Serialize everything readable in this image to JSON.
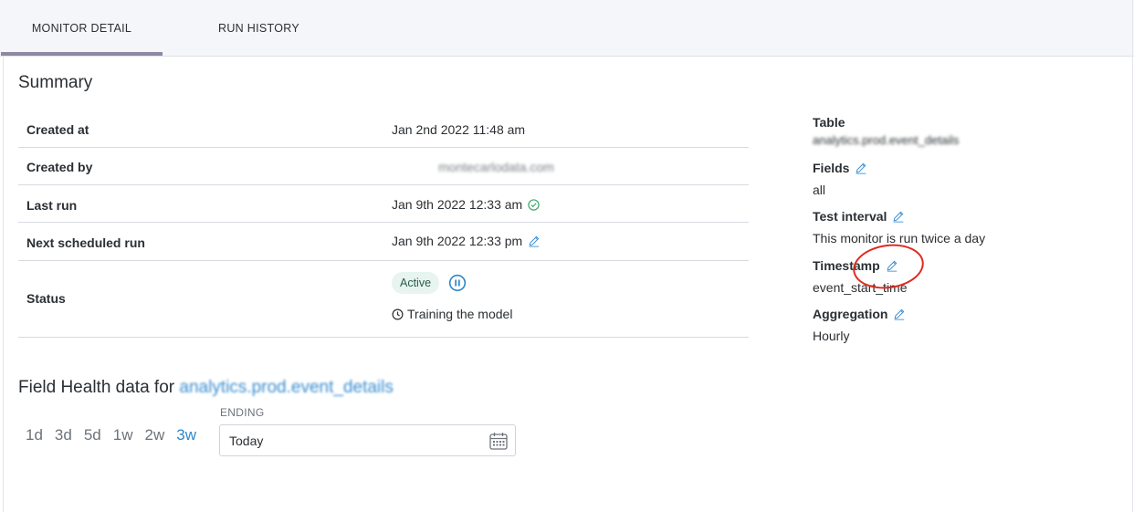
{
  "tabs": [
    {
      "label": "MONITOR DETAIL",
      "active": true
    },
    {
      "label": "RUN HISTORY",
      "active": false
    }
  ],
  "summary": {
    "title": "Summary",
    "rows": {
      "created_at": {
        "label": "Created at",
        "value": "Jan 2nd 2022 11:48 am"
      },
      "created_by": {
        "label": "Created by",
        "value": "montecarlodata.com"
      },
      "last_run": {
        "label": "Last run",
        "value": "Jan 9th 2022 12:33 am",
        "status_icon": "check-circle-icon"
      },
      "next_run": {
        "label": "Next scheduled run",
        "value": "Jan 9th 2022 12:33 pm"
      },
      "status": {
        "label": "Status",
        "badge": "Active",
        "training": "Training the model"
      }
    }
  },
  "details": {
    "table": {
      "label": "Table",
      "value": "analytics.prod.event_details"
    },
    "fields": {
      "label": "Fields",
      "value": "all"
    },
    "test_interval": {
      "label": "Test interval",
      "value": "This monitor is run twice a day"
    },
    "timestamp": {
      "label": "Timestamp",
      "value": "event_start_time"
    },
    "aggregation": {
      "label": "Aggregation",
      "value": "Hourly"
    }
  },
  "field_health": {
    "title_prefix": "Field Health data for",
    "title_table": "analytics.prod.event_details",
    "ranges": [
      "1d",
      "3d",
      "5d",
      "1w",
      "2w",
      "3w"
    ],
    "active_range": "3w",
    "ending_label": "ENDING",
    "ending_value": "Today"
  },
  "colors": {
    "accent": "#2f87c8",
    "active_badge_bg": "#e7f4ef",
    "annotation": "#e02a1f",
    "success": "#3fa56d"
  }
}
